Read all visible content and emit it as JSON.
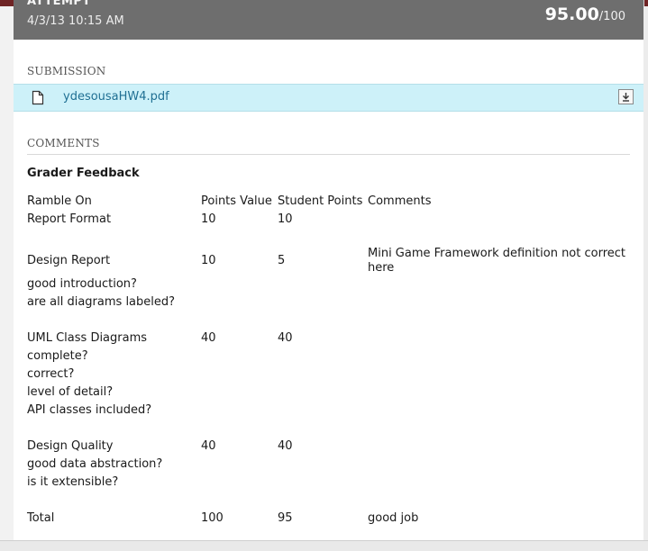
{
  "attempt": {
    "label": "ATTEMPT",
    "date": "4/3/13 10:15 AM",
    "score": "95.00",
    "score_max": "/100"
  },
  "submission": {
    "section_label": "SUBMISSION",
    "file_name": "ydesousaHW4.pdf",
    "file_icon": "document-icon",
    "download_icon": "download-icon"
  },
  "comments": {
    "section_label": "COMMENTS",
    "feedback_title": "Grader Feedback",
    "headers": {
      "item": "Ramble On",
      "points": "Points Value",
      "student": "Student Points",
      "comments": "Comments"
    },
    "rows": [
      {
        "item": "Report Format",
        "points": "10",
        "student": "10",
        "comment": ""
      },
      {
        "item": "Design Report",
        "points": "10",
        "student": "5",
        "comment": "Mini Game Framework definition not correct here"
      },
      {
        "item": "good introduction?"
      },
      {
        "item": "are all diagrams labeled?"
      },
      {
        "item": "UML Class Diagrams",
        "points": "40",
        "student": "40"
      },
      {
        "item": "complete?"
      },
      {
        "item": "correct?"
      },
      {
        "item": "level of detail?"
      },
      {
        "item": "API classes included?"
      },
      {
        "item": "Design Quality",
        "points": "40",
        "student": "40"
      },
      {
        "item": "good data abstraction?"
      },
      {
        "item": "is it extensible?"
      },
      {
        "item": "Total",
        "points": "100",
        "student": "95",
        "comment": "good job"
      }
    ]
  }
}
